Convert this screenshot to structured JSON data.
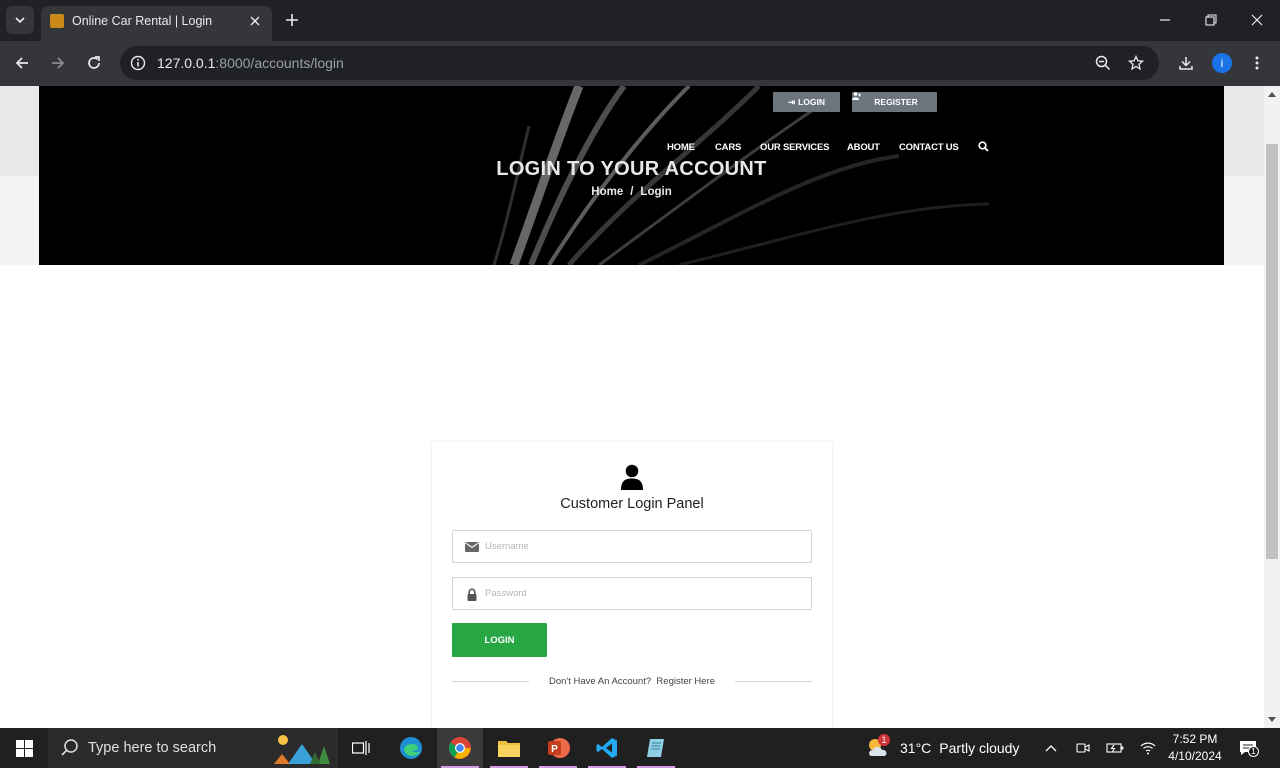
{
  "browser": {
    "tab_title": "Online Car Rental | Login",
    "url_host": "127.0.0.1",
    "url_rest": ":8000/accounts/login"
  },
  "site": {
    "top_buttons": {
      "login": "LOGIN",
      "register": "REGISTER"
    },
    "menu": [
      "HOME",
      "CARS",
      "OUR SERVICES",
      "ABOUT",
      "CONTACT US"
    ],
    "hero_title": "LOGIN TO YOUR ACCOUNT",
    "breadcrumb": {
      "home": "Home",
      "separator": "/",
      "current": "Login"
    }
  },
  "login_card": {
    "title": "Customer Login Panel",
    "username_placeholder": "Username",
    "password_placeholder": "Password",
    "login_button": "LOGIN",
    "footer_prefix": "Don't Have An Account?",
    "footer_link": "Register Here"
  },
  "taskbar": {
    "search_placeholder": "Type here to search",
    "weather_temp": "31°C",
    "weather_desc": "Partly cloudy",
    "weather_badge": "1",
    "time": "7:52 PM",
    "date": "4/10/2024",
    "notification_count": "1"
  },
  "colors": {
    "login_green": "#28a745",
    "top_button_gray": "#6c757d",
    "chrome_dark": "#202124"
  }
}
